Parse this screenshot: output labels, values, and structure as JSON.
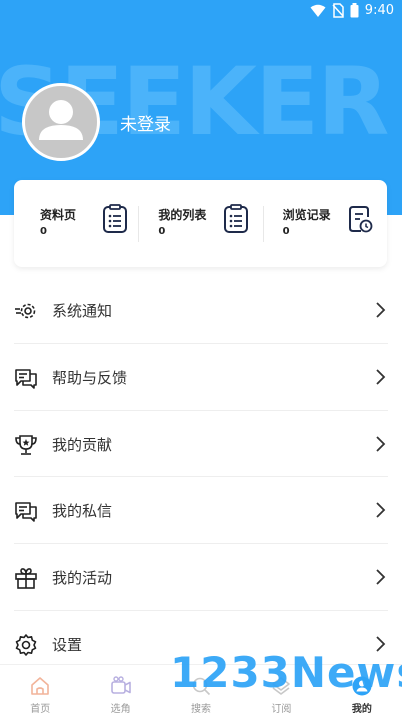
{
  "status_bar": {
    "time": "9:40"
  },
  "hero": {
    "watermark_text": "SEEKER",
    "login_label": "未登录"
  },
  "stats": [
    {
      "label": "资料页",
      "value": "0",
      "icon": "document-list-icon"
    },
    {
      "label": "我的列表",
      "value": "0",
      "icon": "list-icon"
    },
    {
      "label": "浏览记录",
      "value": "0",
      "icon": "history-document-icon"
    }
  ],
  "menu": [
    {
      "label": "系统通知",
      "icon": "notification-gear-icon"
    },
    {
      "label": "帮助与反馈",
      "icon": "feedback-chat-icon"
    },
    {
      "label": "我的贡献",
      "icon": "trophy-icon"
    },
    {
      "label": "我的私信",
      "icon": "message-icon"
    },
    {
      "label": "我的活动",
      "icon": "gift-icon"
    },
    {
      "label": "设置",
      "icon": "settings-icon"
    }
  ],
  "tabbar": [
    {
      "label": "首页",
      "icon": "home-icon"
    },
    {
      "label": "选角",
      "icon": "camera-icon"
    },
    {
      "label": "搜索",
      "icon": "search-icon"
    },
    {
      "label": "订阅",
      "icon": "subscribe-icon"
    },
    {
      "label": "我的",
      "icon": "profile-icon",
      "active": true
    }
  ],
  "overlay_watermark": "1233News",
  "colors": {
    "accent": "#2da3f7",
    "navy_icon": "#1e2a4a"
  }
}
